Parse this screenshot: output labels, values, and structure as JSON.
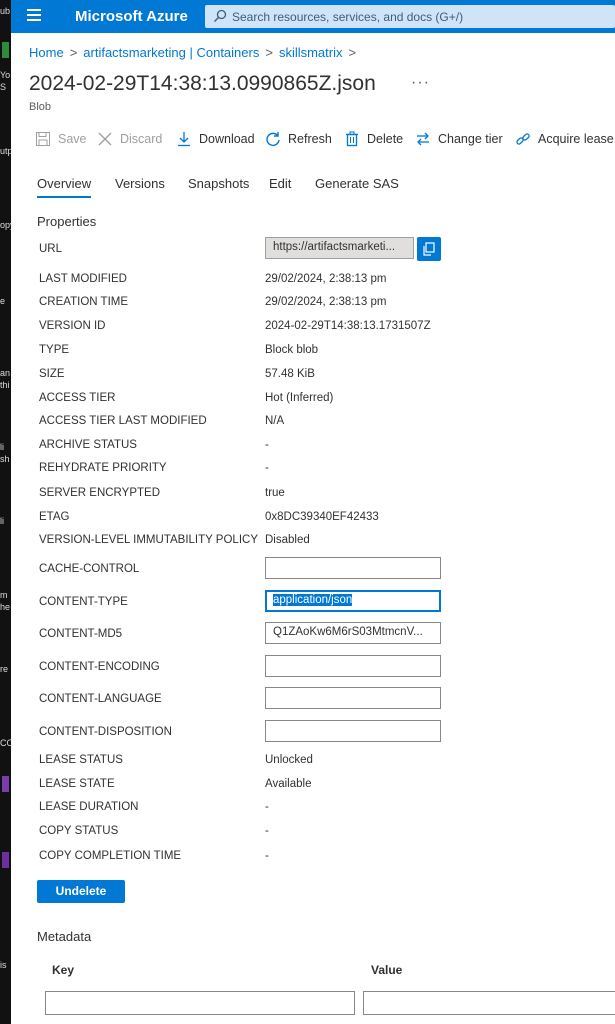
{
  "topbar": {
    "brand": "Microsoft Azure",
    "search_placeholder": "Search resources, services, and docs (G+/)"
  },
  "breadcrumb": [
    "Home",
    "artifactsmarketing | Containers",
    "skillsmatrix"
  ],
  "page": {
    "title": "2024-02-29T14:38:13.0990865Z.json",
    "more": "···",
    "subtitle": "Blob"
  },
  "toolbar": {
    "save": "Save",
    "discard": "Discard",
    "download": "Download",
    "refresh": "Refresh",
    "delete": "Delete",
    "change_tier": "Change tier",
    "acquire_lease": "Acquire lease"
  },
  "tabs": [
    "Overview",
    "Versions",
    "Snapshots",
    "Edit",
    "Generate SAS"
  ],
  "properties_heading": "Properties",
  "url": {
    "label": "URL",
    "value": "https://artifactsmarketi..."
  },
  "properties": [
    {
      "label": "LAST MODIFIED",
      "value": "29/02/2024, 2:38:13 pm"
    },
    {
      "label": "CREATION TIME",
      "value": "29/02/2024, 2:38:13 pm"
    },
    {
      "label": "VERSION ID",
      "value": "2024-02-29T14:38:13.1731507Z"
    },
    {
      "label": "TYPE",
      "value": "Block blob"
    },
    {
      "label": "SIZE",
      "value": "57.48 KiB"
    },
    {
      "label": "ACCESS TIER",
      "value": "Hot (Inferred)"
    },
    {
      "label": "ACCESS TIER LAST MODIFIED",
      "value": "N/A"
    },
    {
      "label": "ARCHIVE STATUS",
      "value": "-"
    },
    {
      "label": "REHYDRATE PRIORITY",
      "value": "-"
    },
    {
      "label": "SERVER ENCRYPTED",
      "value": "true"
    },
    {
      "label": "ETAG",
      "value": "0x8DC39340EF42433"
    },
    {
      "label": "VERSION-LEVEL IMMUTABILITY POLICY",
      "value": "Disabled"
    }
  ],
  "editable": [
    {
      "label": "CACHE-CONTROL",
      "value": ""
    },
    {
      "label": "CONTENT-TYPE",
      "value": "application/json"
    },
    {
      "label": "CONTENT-MD5",
      "value": "Q1ZAoKw6M6rS03MtmcnV..."
    },
    {
      "label": "CONTENT-ENCODING",
      "value": ""
    },
    {
      "label": "CONTENT-LANGUAGE",
      "value": ""
    },
    {
      "label": "CONTENT-DISPOSITION",
      "value": ""
    }
  ],
  "lease": [
    {
      "label": "LEASE STATUS",
      "value": "Unlocked"
    },
    {
      "label": "LEASE STATE",
      "value": "Available"
    },
    {
      "label": "LEASE DURATION",
      "value": "-"
    },
    {
      "label": "COPY STATUS",
      "value": "-"
    },
    {
      "label": "COPY COMPLETION TIME",
      "value": "-"
    }
  ],
  "undelete": "Undelete",
  "metadata": {
    "heading": "Metadata",
    "key": "Key",
    "value": "Value"
  },
  "background_fragments": [
    "ub",
    "Yo",
    "S",
    "utp",
    "opy",
    "e",
    "an",
    "thi",
    "li",
    "sh",
    "li",
    "m",
    "he",
    "re",
    "CO",
    "is"
  ],
  "colors": {
    "accent": "#0078d4",
    "search_bg": "#cfe4f6"
  }
}
